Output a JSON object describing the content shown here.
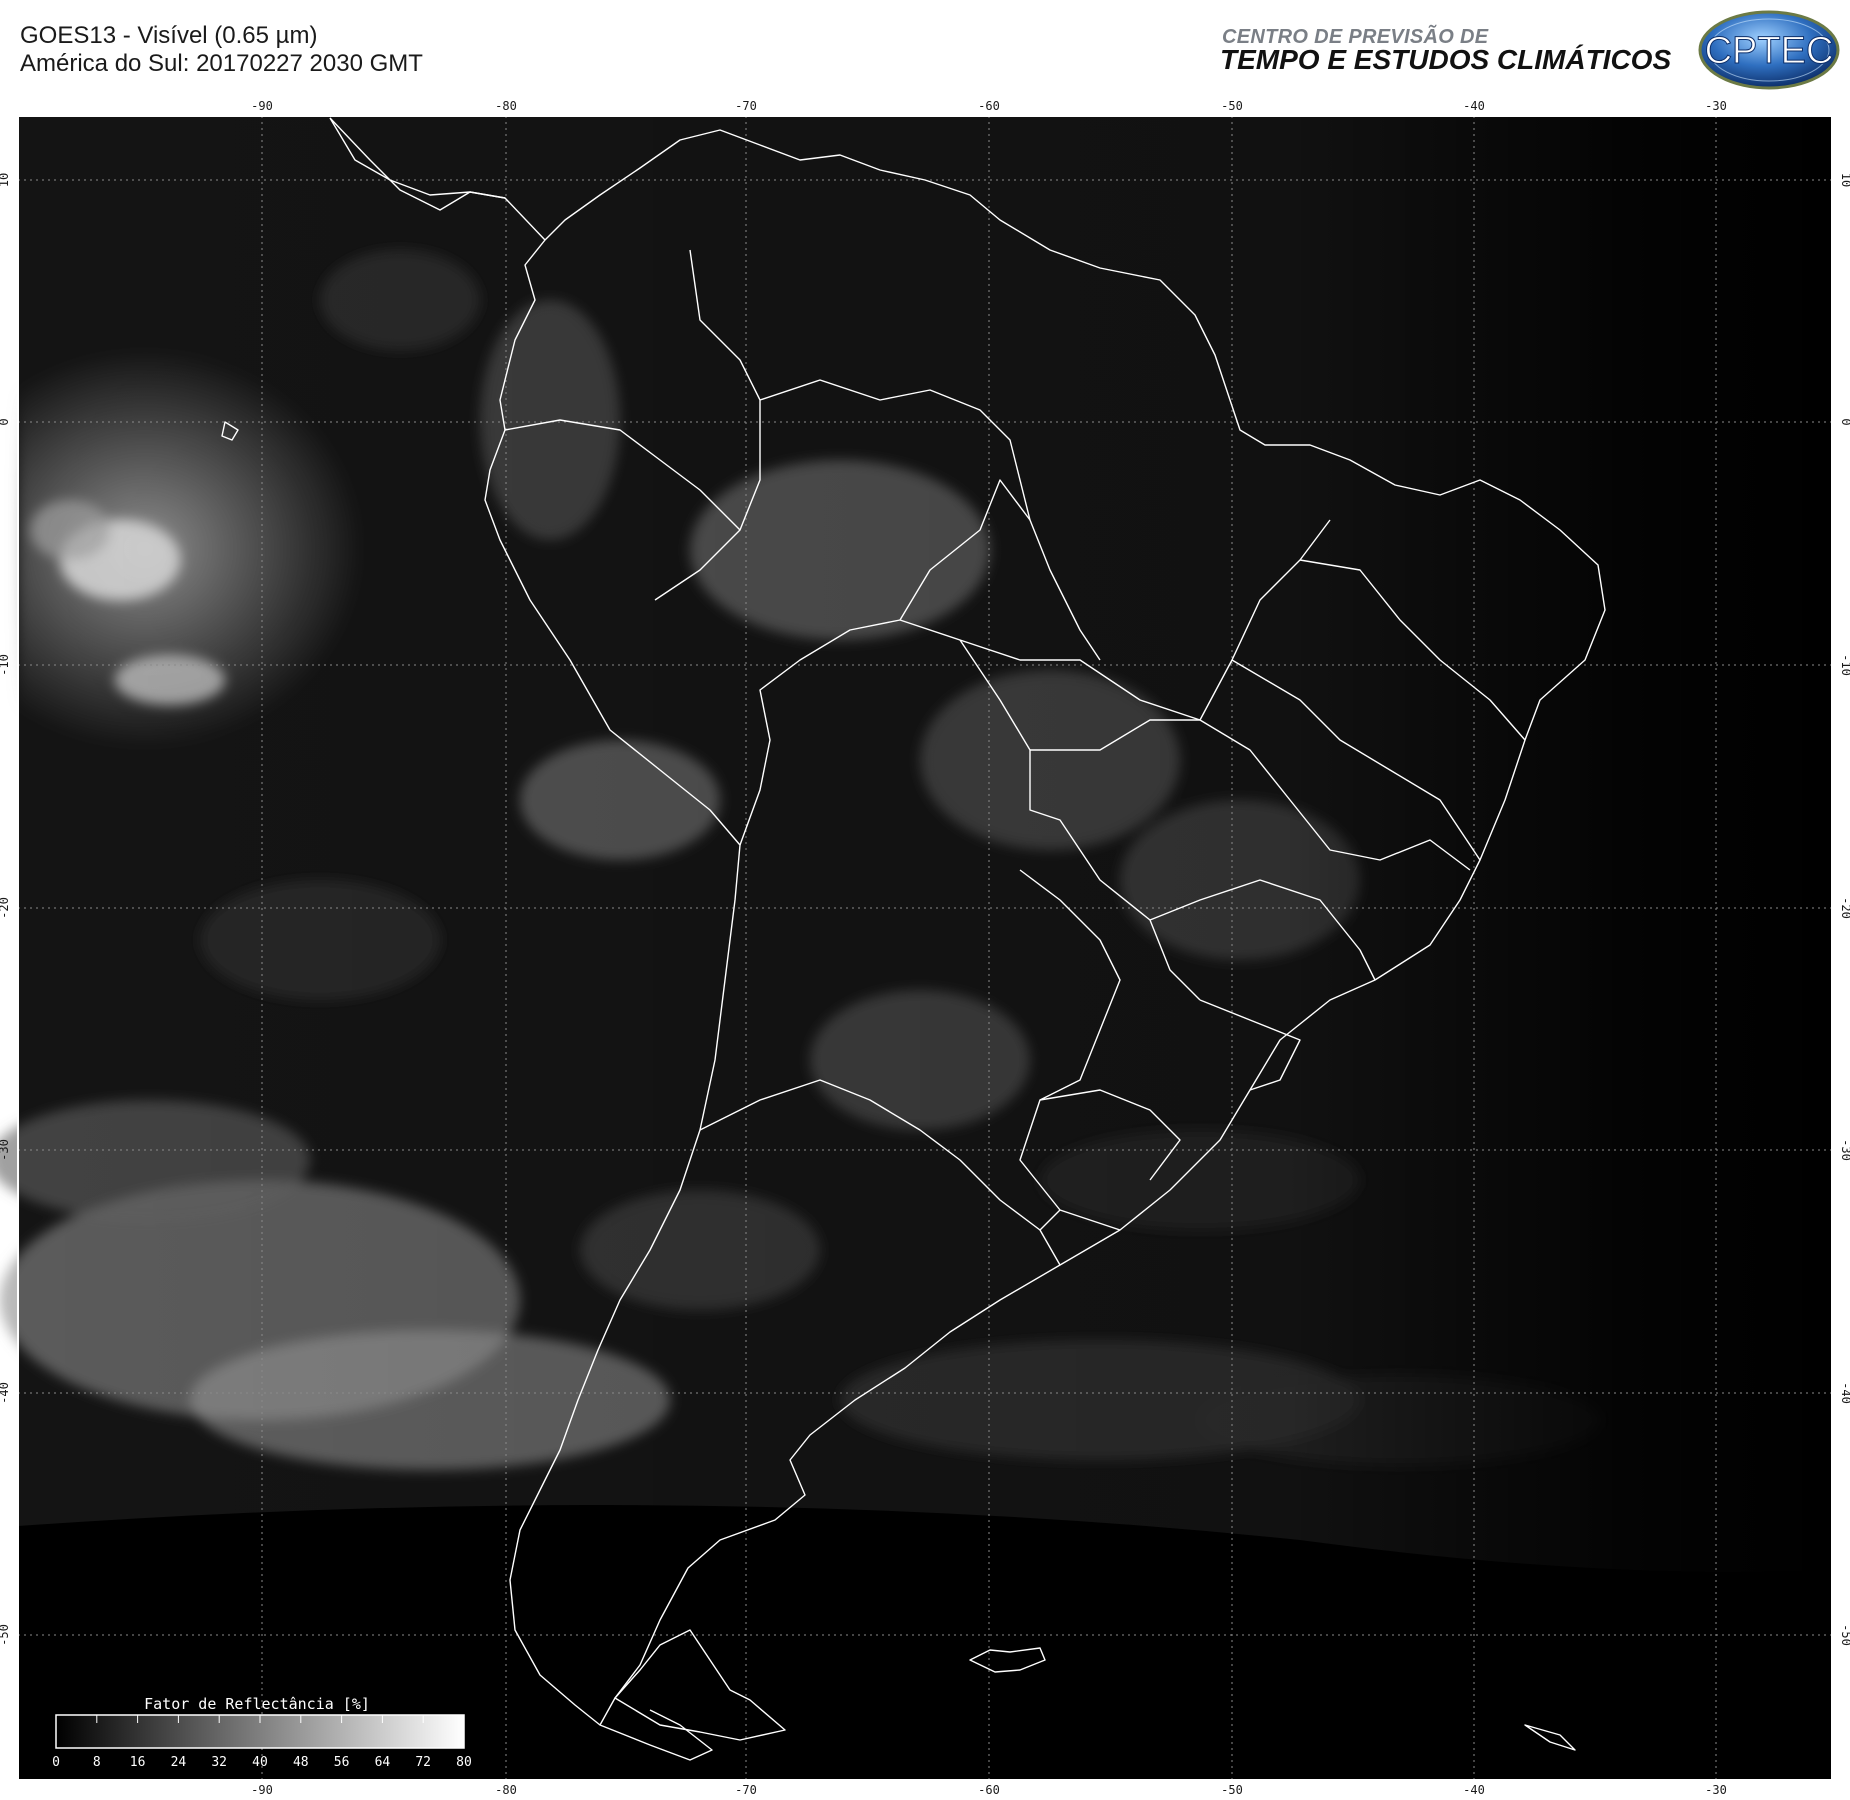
{
  "header": {
    "title_line1": "GOES13 - Visível (0.65 µm)",
    "title_line2": "América do Sul: 20170227 2030 GMT",
    "org_line1": "CENTRO DE PREVISÃO DE",
    "org_line2": "TEMPO E ESTUDOS CLIMÁTICOS",
    "logo_text": "CPTEC"
  },
  "map": {
    "lon_ticks": [
      "-90",
      "-80",
      "-70",
      "-60",
      "-50",
      "-40",
      "-30"
    ],
    "lat_ticks": [
      "10",
      "0",
      "-10",
      "-20",
      "-30",
      "-40",
      "-50"
    ],
    "grid": true,
    "colors": {
      "background": "#000000",
      "border": "#ffffff",
      "grid": "#8a8a8a"
    }
  },
  "colorbar": {
    "title": "Fator de Reflectância [%]",
    "ticks": [
      "0",
      "8",
      "16",
      "24",
      "32",
      "40",
      "48",
      "56",
      "64",
      "72",
      "80"
    ],
    "range": [
      0,
      80
    ]
  }
}
